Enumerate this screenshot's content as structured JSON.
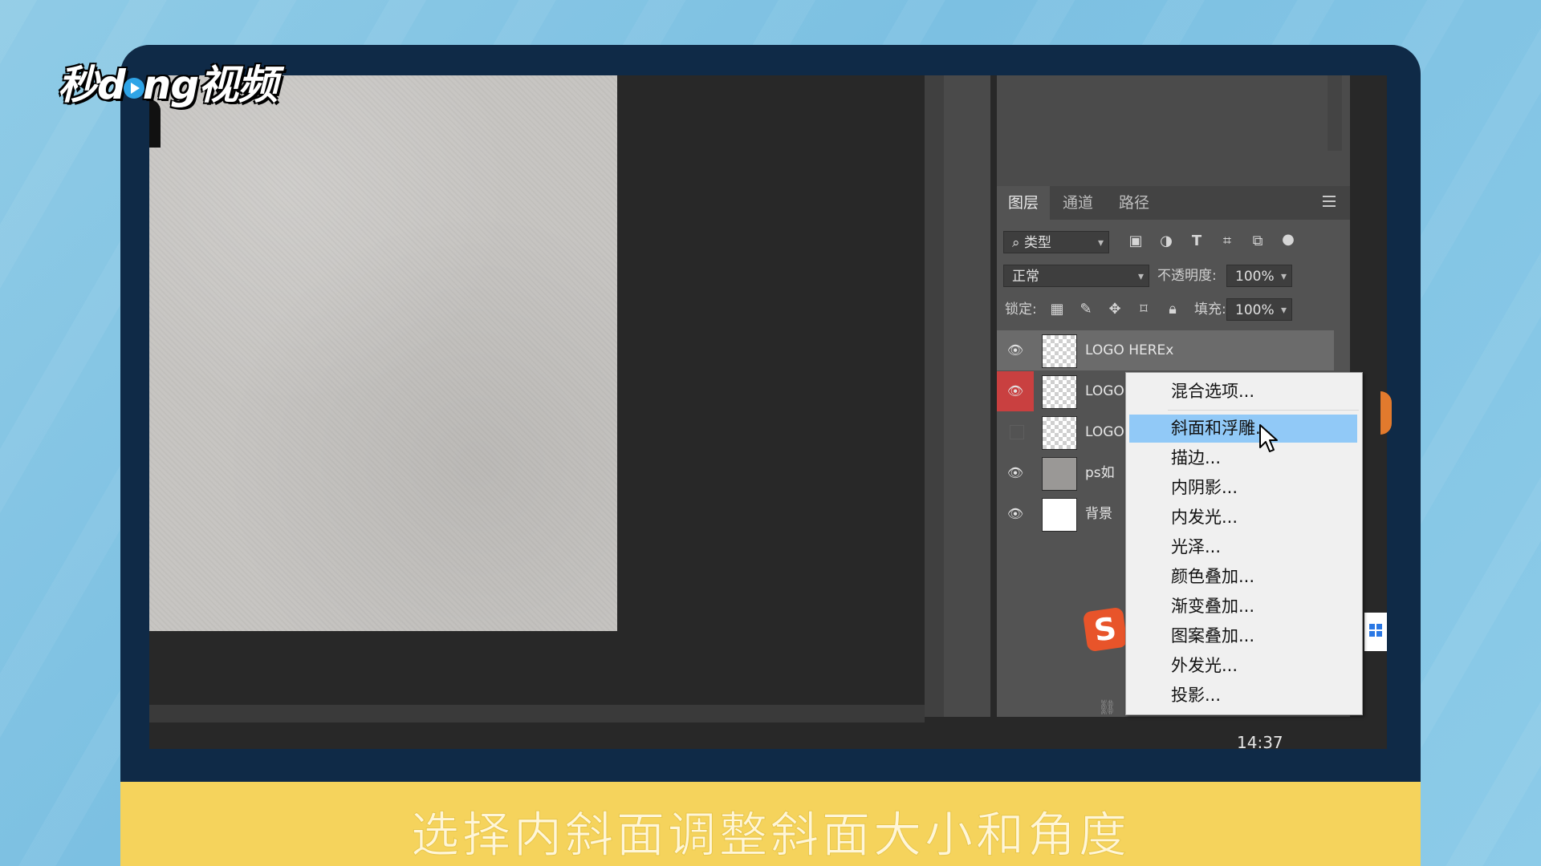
{
  "watermark": {
    "brand": "秒dong视频",
    "brand_pre": "秒d",
    "brand_post": "ng视频"
  },
  "caption": "选择内斜面调整斜面大小和角度",
  "layers_panel": {
    "tabs": [
      "图层",
      "通道",
      "路径"
    ],
    "active_tab": "图层",
    "filter_kind": "类型",
    "blend_mode": "正常",
    "opacity_label": "不透明度:",
    "opacity_value": "100%",
    "lock_label": "锁定:",
    "fill_label": "填充:",
    "fill_value": "100%",
    "layers": [
      {
        "name": "LOGO HEREx",
        "visible": true,
        "selected": true
      },
      {
        "name": "LOGO",
        "visible": true,
        "selected": false
      },
      {
        "name": "LOGO",
        "visible": false,
        "selected": false
      },
      {
        "name": "ps如",
        "visible": true,
        "selected": false
      },
      {
        "name": "背景",
        "visible": true,
        "selected": false
      }
    ]
  },
  "context_menu": {
    "items": [
      "混合选项...",
      "斜面和浮雕...",
      "描边...",
      "内阴影...",
      "内发光...",
      "光泽...",
      "颜色叠加...",
      "渐变叠加...",
      "图案叠加...",
      "外发光...",
      "投影..."
    ],
    "highlighted": "斜面和浮雕..."
  },
  "taskbar": {
    "clock": "14:37"
  },
  "icons": {
    "eye": "eye-icon",
    "search": "search-icon",
    "panel_menu": "panel-menu-icon",
    "cursor": "mouse-cursor-icon"
  },
  "colors": {
    "background": "#8fcbe6",
    "monitor_frame": "#0f2a47",
    "caption_bar": "#f5d35c",
    "menu_highlight": "#91c9f7",
    "visibility_active": "#c94040"
  }
}
